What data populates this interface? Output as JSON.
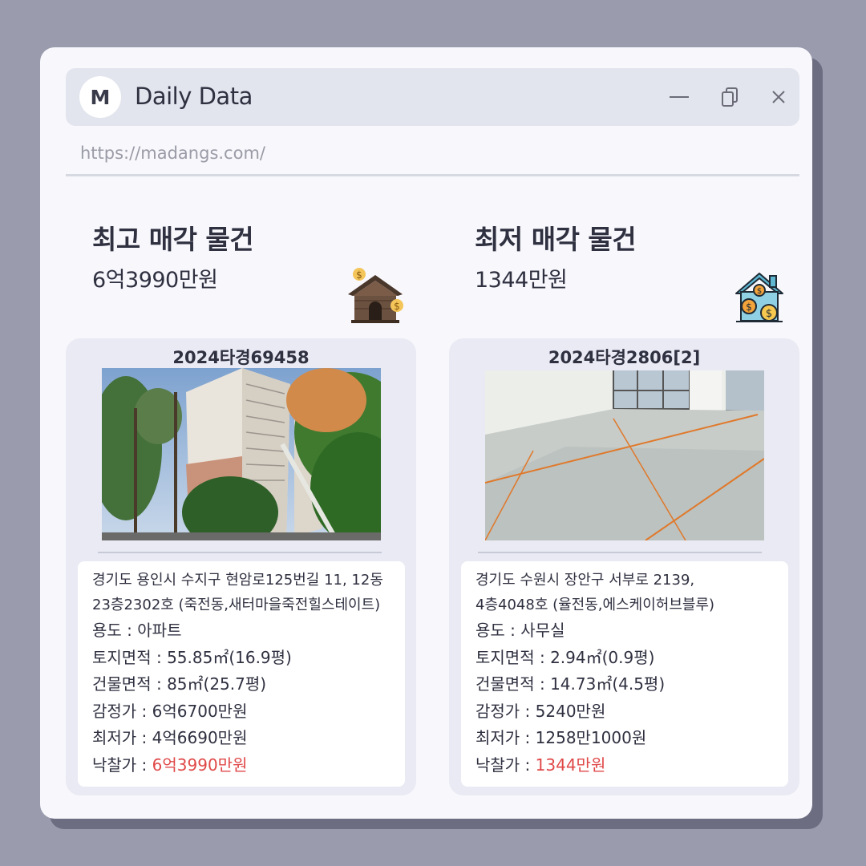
{
  "window": {
    "logo_letter": "M",
    "title": "Daily Data",
    "url": "https://madangs.com/",
    "controls": [
      "minimize-icon",
      "restore-icon",
      "close-icon"
    ]
  },
  "colors": {
    "background": "#9a9bad",
    "window": "#f7f7fc",
    "card": "#e9eaf3",
    "highlight": "#e04848"
  },
  "highest": {
    "heading": "최고 매각 물건",
    "amount": "6억3990만원",
    "icon": "house-money-icon",
    "case_number": "2024타경69458",
    "address_line1": "경기도 용인시 수지구 현암로125번길 11, 12동",
    "address_line2": "23층2302호 (죽전동,새터마을죽전힐스테이트)",
    "usage_label": "용도 : ",
    "usage": "아파트",
    "land_label": "토지면적 : ",
    "land_area": "55.85㎡(16.9평)",
    "building_label": "건물면적 : ",
    "building_area": "85㎡(25.7평)",
    "appraisal_label": "감정가 : ",
    "appraisal": "6억6700만원",
    "minimum_label": "최저가 : ",
    "minimum": "4억6690만원",
    "winning_label": "낙찰가 : ",
    "winning": "6억3990만원"
  },
  "lowest": {
    "heading": "최저 매각 물건",
    "amount": "1344만원",
    "icon": "house-coins-icon",
    "case_number": "2024타경2806[2]",
    "address_line1": "경기도 수원시 장안구 서부로 2139,",
    "address_line2": "4층4048호 (율전동,에스케이허브블루)",
    "usage_label": "용도 : ",
    "usage": "사무실",
    "land_label": "토지면적 : ",
    "land_area": "2.94㎡(0.9평)",
    "building_label": "건물면적 : ",
    "building_area": "14.73㎡(4.5평)",
    "appraisal_label": "감정가 : ",
    "appraisal": "5240만원",
    "minimum_label": "최저가 : ",
    "minimum": "1258만1000원",
    "winning_label": "낙찰가 : ",
    "winning": "1344만원"
  }
}
